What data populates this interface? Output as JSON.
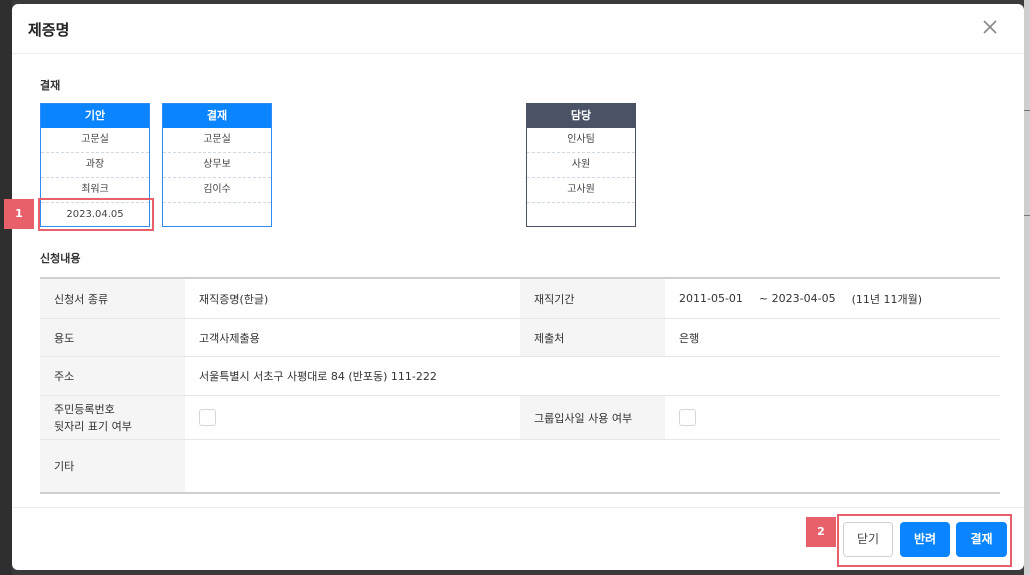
{
  "modal": {
    "title": "제증명"
  },
  "approval": {
    "section_title": "결재",
    "columns": [
      {
        "header": "기안",
        "cells": [
          "고문실",
          "과장",
          "최워크",
          "2023.04.05"
        ]
      },
      {
        "header": "결재",
        "cells": [
          "고문실",
          "상무보",
          "김이수",
          ""
        ]
      },
      {
        "header": "담당",
        "cells": [
          "인사팀",
          "사원",
          "고사원",
          ""
        ]
      }
    ]
  },
  "request": {
    "section_title": "신청내용",
    "rows": {
      "doc_type_label": "신청서 종류",
      "doc_type_value": "재직증명(한글)",
      "period_label": "재직기간",
      "period_start": "2011-05-01",
      "period_sep": "~ 2023-04-05",
      "period_duration": "(11년 11개월)",
      "purpose_label": "용도",
      "purpose_value": "고객사제출용",
      "submit_to_label": "제출처",
      "submit_to_value": "은행",
      "address_label": "주소",
      "address_value": "서울특별시 서초구 사평대로 84 (반포동) 111-222",
      "rrn_label_line1": "주민등록번호",
      "rrn_label_line2": "뒷자리 표기 여부",
      "group_date_label": "그룹입사일 사용 여부",
      "etc_label": "기타",
      "etc_value": ""
    }
  },
  "footer": {
    "close_label": "닫기",
    "reject_label": "반려",
    "approve_label": "결재"
  },
  "annotations": {
    "badge1": "1",
    "badge2": "2"
  },
  "colors": {
    "accent": "#0a84ff",
    "dark_header": "#4a5366",
    "highlight": "#e8606a"
  }
}
